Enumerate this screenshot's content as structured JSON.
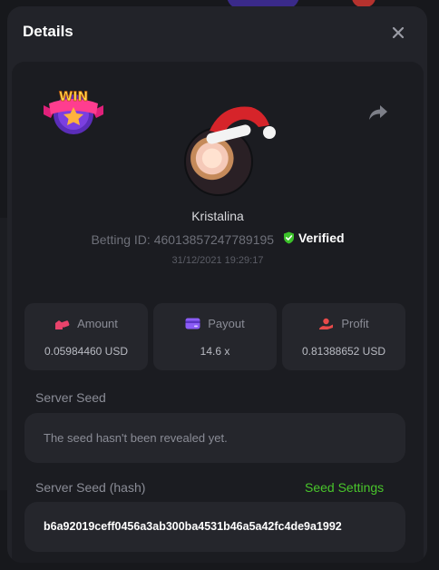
{
  "modal": {
    "title": "Details",
    "close_icon": "close-icon",
    "share_icon": "share-icon"
  },
  "badge": {
    "label": "WIN"
  },
  "user": {
    "name": "Kristalina",
    "betting_id_label": "Betting ID: 46013857247789195",
    "verified_label": "Verified",
    "timestamp": "31/12/2021 19:29:17"
  },
  "stats": [
    {
      "label": "Amount",
      "value": "0.05984460 USD",
      "icon": "amount-icon"
    },
    {
      "label": "Payout",
      "value": "14.6 x",
      "icon": "payout-icon"
    },
    {
      "label": "Profit",
      "value": "0.81388652 USD",
      "icon": "profit-icon"
    }
  ],
  "server_seed": {
    "label": "Server Seed",
    "value": "The seed hasn't been revealed yet."
  },
  "server_seed_hash": {
    "label": "Server Seed (hash)",
    "settings_link": "Seed Settings",
    "value": "b6a92019ceff0456a3ab300ba4531b46a5a42fc4de9a1992"
  },
  "colors": {
    "accent_green": "#49c52b",
    "stat_icon_pink": "#e8436b",
    "stat_icon_purple": "#8b5cf6",
    "stat_icon_red": "#e84a4a"
  }
}
